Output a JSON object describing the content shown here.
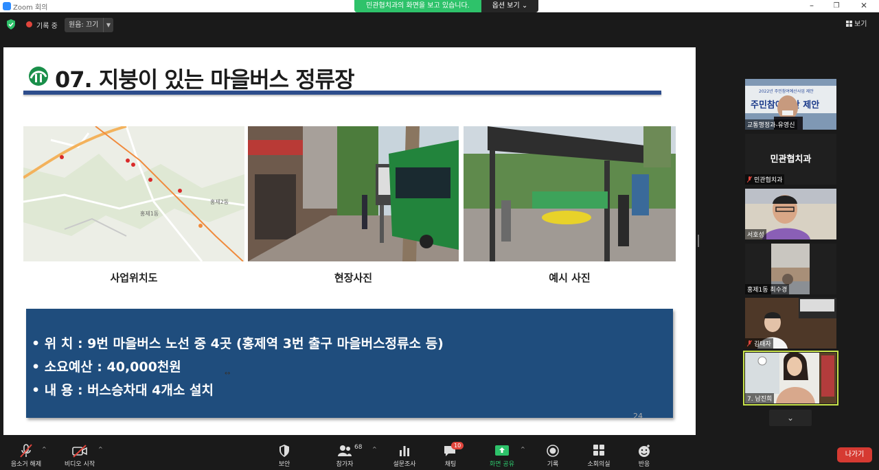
{
  "window": {
    "app_title": "Zoom 회의"
  },
  "share_banner": {
    "message": "민관협치과의 화면을 보고 있습니다.",
    "options_label": "옵션 보기 ⌄"
  },
  "top_bar": {
    "recording_label": "기록 중",
    "audio_label": "원음: 끄기",
    "view_label": "보기"
  },
  "slide": {
    "title": "07. 지붕이 있는 마을버스 정류장",
    "captions": [
      "사업위치도",
      "현장사진",
      "예시 사진"
    ],
    "info_lines": [
      "• 위      치 : 9번 마을버스 노선 중 4곳 (홍제역 3번 출구 마을버스정류소 등)",
      "• 소요예산 : 40,000천원",
      "• 내      용 : 버스승차대 4개소 설치"
    ],
    "page_number": "24",
    "map_labels": [
      "홍제2동",
      "홍제1동"
    ],
    "photo_text": [
      "2022년 주민참여예산사업 제안",
      "주민참여예산 제안"
    ]
  },
  "participants": [
    {
      "name": "교통행정과-유영신",
      "video": true,
      "muted": false
    },
    {
      "name": "민관협치과",
      "video": false,
      "muted": true,
      "display_text": "민관협치과"
    },
    {
      "name": "서호성",
      "video": true,
      "muted": false
    },
    {
      "name": "홍제1동 최수경",
      "video": true,
      "muted": false
    },
    {
      "name": "김태자",
      "video": true,
      "muted": true
    },
    {
      "name": "7. 남진희",
      "video": true,
      "muted": false,
      "active_speaker": true
    }
  ],
  "toolbar": {
    "unmute": "음소거 해제",
    "start_video": "비디오 시작",
    "security": "보안",
    "participants": "참가자",
    "participants_count": "68",
    "polls": "설문조사",
    "chat": "채팅",
    "chat_badge": "10",
    "share_screen": "화면 공유",
    "record": "기록",
    "breakout": "소회의실",
    "reactions": "반응",
    "leave": "나가기"
  },
  "colors": {
    "share_green": "#2ec26a",
    "slide_box_blue": "#1f4d7d",
    "title_rule": "#2d4d8c",
    "leave_red": "#d63a32",
    "active_speaker_outline": "#c8e34a"
  }
}
